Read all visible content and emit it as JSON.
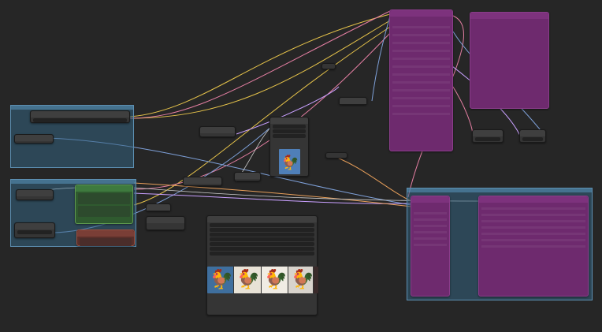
{
  "app": {
    "name": ""
  },
  "side_labels": [
    "",
    "",
    ""
  ],
  "nodes": {
    "load_checkpoint": {
      "title": ""
    },
    "clip_text_positive": {
      "title": ""
    },
    "clip_text_negative": {
      "title": ""
    },
    "ksampler": {
      "title": ""
    },
    "preview_image": {
      "title": ""
    },
    "vae_decode": {
      "title": ""
    },
    "save_image": {
      "title": ""
    }
  },
  "colors": {
    "canvas_bg": "#262626",
    "node_bg": "#353535",
    "group_blue": "#336280",
    "purple_node": "#6e2a6e",
    "green_node": "#2f5a2f",
    "red_node": "#5a2f2a",
    "wire_colors": [
      "#e6c34a",
      "#e57fa3",
      "#7ea0d8",
      "#c9a0ff",
      "#e89f5a",
      "#cfcfcf"
    ]
  },
  "preview": {
    "images": [
      {
        "icon": "rooster-icon",
        "bg": "#3f6f9e"
      },
      {
        "icon": "rooster-icon",
        "bg": "#e8e2d6"
      },
      {
        "icon": "rooster-icon",
        "bg": "#f0ece4"
      },
      {
        "icon": "rooster-icon",
        "bg": "#d8d3cc"
      },
      {
        "icon": "rooster-icon",
        "bg": "#3a2a2a"
      }
    ]
  }
}
